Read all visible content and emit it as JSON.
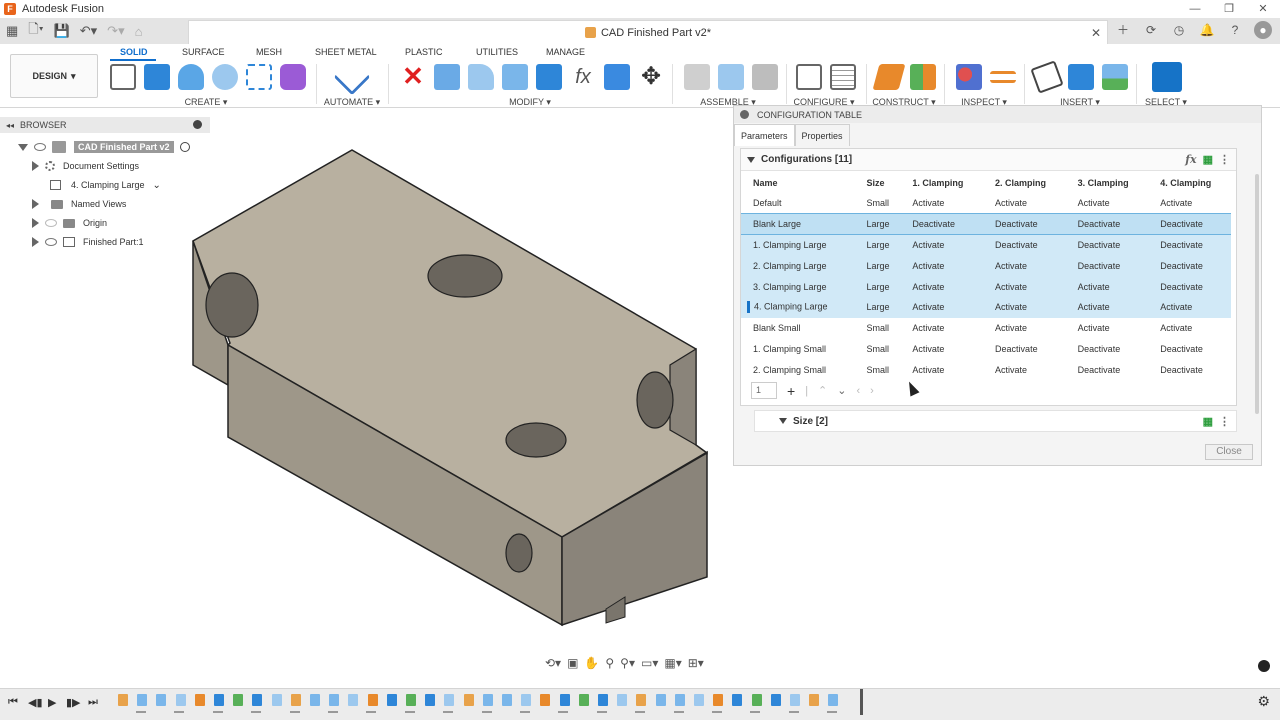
{
  "app": {
    "title": "Autodesk Fusion",
    "document_title": "CAD Finished Part v2*"
  },
  "ribbon": {
    "tabs": [
      "SOLID",
      "SURFACE",
      "MESH",
      "SHEET METAL",
      "PLASTIC",
      "UTILITIES",
      "MANAGE"
    ],
    "active_tab": "SOLID",
    "workspace": "DESIGN",
    "groups": [
      "CREATE",
      "AUTOMATE",
      "MODIFY",
      "ASSEMBLE",
      "CONFIGURE",
      "CONSTRUCT",
      "INSPECT",
      "INSERT",
      "SELECT"
    ]
  },
  "browser": {
    "header": "BROWSER",
    "items": [
      {
        "label": "CAD Finished Part v2"
      },
      {
        "label": "Document Settings"
      },
      {
        "label": "4. Clamping Large"
      },
      {
        "label": "Named Views"
      },
      {
        "label": "Origin"
      },
      {
        "label": "Finished Part:1"
      }
    ]
  },
  "config_table": {
    "title": "CONFIGURATION TABLE",
    "tabs": [
      "Parameters",
      "Properties"
    ],
    "section_title": "Configurations [11]",
    "columns": [
      "Name",
      "Size",
      "1. Clamping",
      "2. Clamping",
      "3. Clamping",
      "4. Clamping"
    ],
    "rows": [
      [
        "Default",
        "Small",
        "Activate",
        "Activate",
        "Activate",
        "Activate"
      ],
      [
        "Blank Large",
        "Large",
        "Deactivate",
        "Deactivate",
        "Deactivate",
        "Deactivate"
      ],
      [
        "1. Clamping Large",
        "Large",
        "Activate",
        "Deactivate",
        "Deactivate",
        "Deactivate"
      ],
      [
        "2. Clamping Large",
        "Large",
        "Activate",
        "Activate",
        "Deactivate",
        "Deactivate"
      ],
      [
        "3. Clamping Large",
        "Large",
        "Activate",
        "Activate",
        "Activate",
        "Deactivate"
      ],
      [
        "4. Clamping Large",
        "Large",
        "Activate",
        "Activate",
        "Activate",
        "Activate"
      ],
      [
        "Blank Small",
        "Small",
        "Activate",
        "Activate",
        "Activate",
        "Activate"
      ],
      [
        "1. Clamping Small",
        "Small",
        "Activate",
        "Deactivate",
        "Deactivate",
        "Deactivate"
      ],
      [
        "2. Clamping Small",
        "Small",
        "Activate",
        "Activate",
        "Deactivate",
        "Deactivate"
      ]
    ],
    "page_value": "1",
    "size_section": "Size [2]",
    "close_label": "Close",
    "fx_label": "fx"
  },
  "colors": {
    "accent": "#0f6ecd",
    "selection": "#d1e9f7",
    "part_top": "#b8b0a0",
    "part_front": "#9e9789",
    "part_side": "#8a847a"
  }
}
